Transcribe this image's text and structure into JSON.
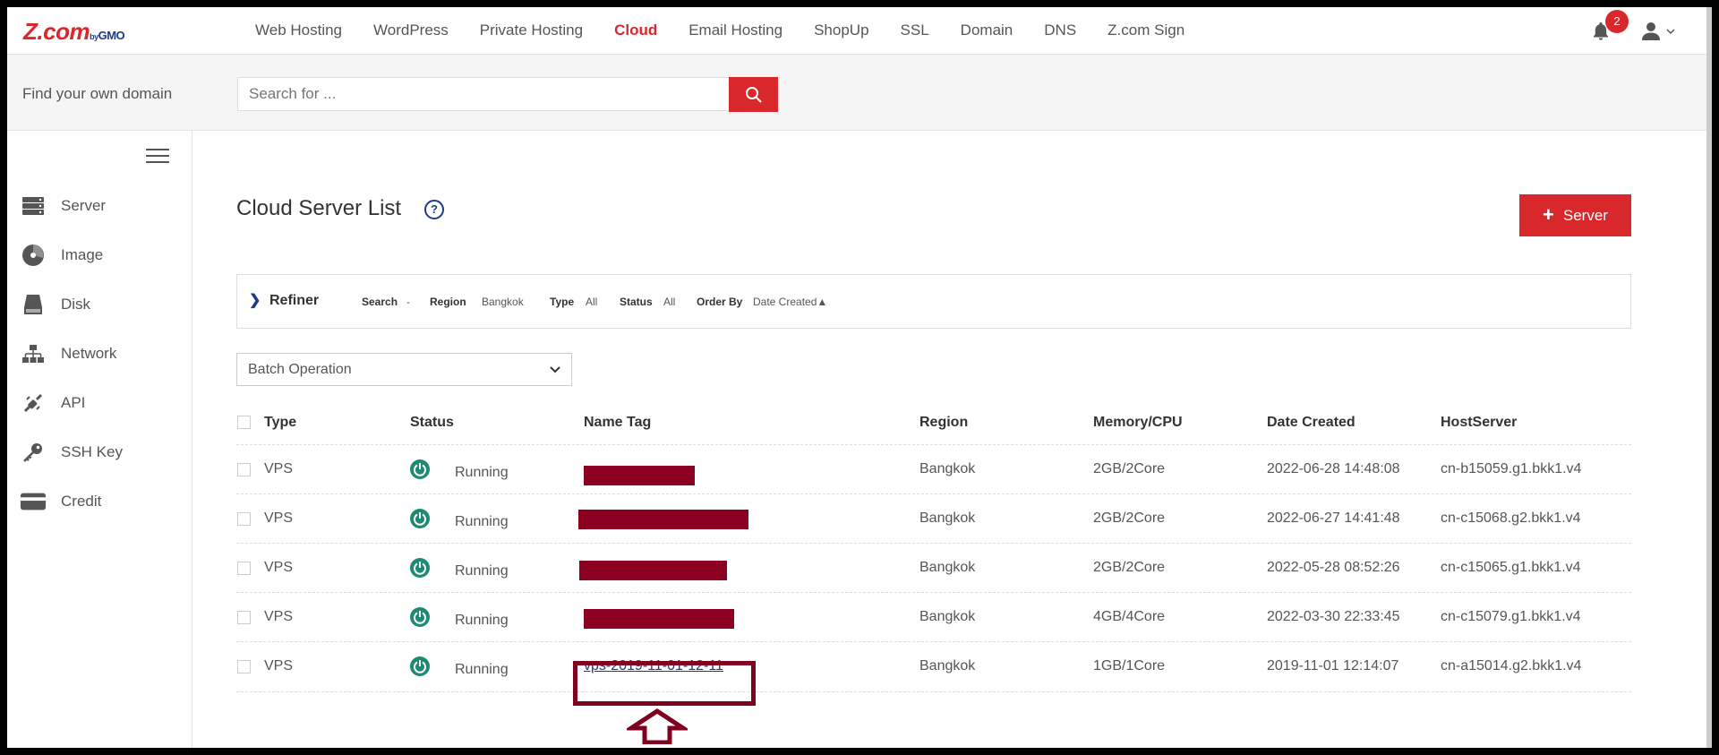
{
  "brand": {
    "logo": "Z.com",
    "by": "by",
    "gmo": "GMO"
  },
  "nav": {
    "items": [
      "Web Hosting",
      "WordPress",
      "Private Hosting",
      "Cloud",
      "Email Hosting",
      "ShopUp",
      "SSL",
      "Domain",
      "DNS",
      "Z.com Sign"
    ],
    "active": "Cloud",
    "notifications": "2"
  },
  "domain_search": {
    "label": "Find your own domain",
    "placeholder": "Search for ..."
  },
  "sidebar": {
    "items": [
      {
        "label": "Server",
        "icon": "server-icon"
      },
      {
        "label": "Image",
        "icon": "image-icon"
      },
      {
        "label": "Disk",
        "icon": "disk-icon"
      },
      {
        "label": "Network",
        "icon": "network-icon"
      },
      {
        "label": "API",
        "icon": "api-icon"
      },
      {
        "label": "SSH Key",
        "icon": "key-icon"
      },
      {
        "label": "Credit",
        "icon": "credit-card-icon"
      }
    ]
  },
  "main": {
    "title": "Cloud Server List",
    "help": "?",
    "add_button": "Server",
    "refiner": {
      "label": "Refiner",
      "search_key": "Search",
      "search_val": "-",
      "region_key": "Region",
      "region_val": "Bangkok",
      "type_key": "Type",
      "type_val": "All",
      "status_key": "Status",
      "status_val": "All",
      "order_key": "Order By",
      "order_val": "Date Created▲"
    },
    "batch": "Batch Operation",
    "table": {
      "headers": [
        "Type",
        "Status",
        "Name Tag",
        "Region",
        "Memory/CPU",
        "Date Created",
        "HostServer"
      ],
      "rows": [
        {
          "type": "VPS",
          "status": "Running",
          "name": "",
          "region": "Bangkok",
          "mem": "2GB/2Core",
          "date": "2022-06-28 14:48:08",
          "host": "cn-b15059.g1.bkk1.v4"
        },
        {
          "type": "VPS",
          "status": "Running",
          "name": "",
          "region": "Bangkok",
          "mem": "2GB/2Core",
          "date": "2022-06-27 14:41:48",
          "host": "cn-c15068.g2.bkk1.v4"
        },
        {
          "type": "VPS",
          "status": "Running",
          "name": "",
          "region": "Bangkok",
          "mem": "2GB/2Core",
          "date": "2022-05-28 08:52:26",
          "host": "cn-c15065.g1.bkk1.v4"
        },
        {
          "type": "VPS",
          "status": "Running",
          "name": "",
          "region": "Bangkok",
          "mem": "4GB/4Core",
          "date": "2022-03-30 22:33:45",
          "host": "cn-c15079.g1.bkk1.v4"
        },
        {
          "type": "VPS",
          "status": "Running",
          "name": "vps-2019-11-01-12-11",
          "region": "Bangkok",
          "mem": "1GB/1Core",
          "date": "2019-11-01 12:14:07",
          "host": "cn-a15014.g2.bkk1.v4"
        }
      ]
    }
  },
  "colors": {
    "accent": "#d8282c",
    "link": "#1e3a8a",
    "running": "#1e8a73",
    "annotation": "#800020"
  }
}
